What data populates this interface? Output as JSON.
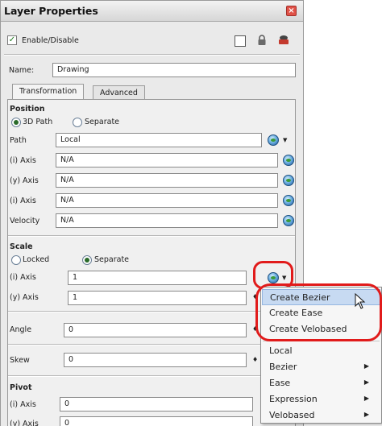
{
  "window": {
    "title": "Layer Properties",
    "close_glyph": "×"
  },
  "enable": {
    "label": "Enable/Disable",
    "checked": true
  },
  "header_icons": [
    "square-icon",
    "lock-icon",
    "camera-icon"
  ],
  "name": {
    "label": "Name:",
    "value": "Drawing"
  },
  "tabs": [
    {
      "label": "Transformation",
      "active": true
    },
    {
      "label": "Advanced",
      "active": false
    }
  ],
  "position": {
    "heading": "Position",
    "radio_3d": "3D Path",
    "radio_separate": "Separate",
    "path_label": "Path",
    "path_value": "Local",
    "x_label": "(i) Axis",
    "x_value": "N/A",
    "y_label": "(y) Axis",
    "y_value": "N/A",
    "z_label": "(i) Axis",
    "z_value": "N/A",
    "velocity_label": "Velocity",
    "velocity_value": "N/A"
  },
  "scale": {
    "heading": "Scale",
    "radio_locked": "Locked",
    "radio_separate": "Separate",
    "x_label": "(i) Axis",
    "x_value": "1",
    "y_label": "(y) Axis",
    "y_value": "1"
  },
  "angle": {
    "label": "Angle",
    "value": "0"
  },
  "skew": {
    "label": "Skew",
    "value": "0"
  },
  "pivot": {
    "heading": "Pivot",
    "x_label": "(i) Axis",
    "x_value": "0",
    "y_label": "(y) Axis",
    "y_value": "0"
  },
  "context_menu": {
    "items_top": [
      "Create Bezier",
      "Create Ease",
      "Create Velobased"
    ],
    "items_bottom": [
      {
        "label": "Local",
        "submenu": false
      },
      {
        "label": "Bezier",
        "submenu": true
      },
      {
        "label": "Ease",
        "submenu": true
      },
      {
        "label": "Expression",
        "submenu": true
      },
      {
        "label": "Velobased",
        "submenu": true
      }
    ],
    "submenu_arrow": "▶",
    "highlighted": "Create Bezier"
  },
  "highlight_color": "#e11b1b"
}
